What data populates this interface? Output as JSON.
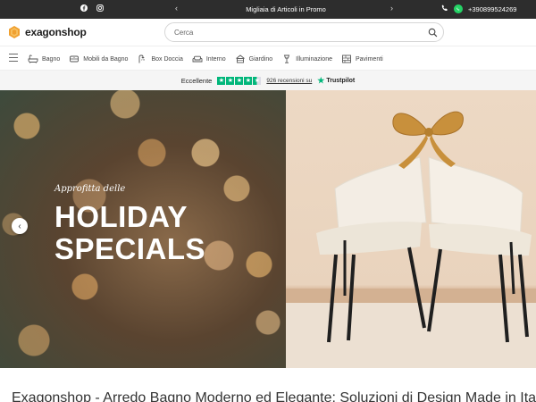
{
  "topbar": {
    "social": [
      {
        "icon": "facebook-icon"
      },
      {
        "icon": "instagram-icon"
      }
    ],
    "promo_text": "Migliaia di Articoli in Promo",
    "phone_icon": "phone-icon",
    "whatsapp_icon": "whatsapp-icon",
    "phone_number": "+390899524269"
  },
  "header": {
    "logo_text": "exagonshop",
    "search_placeholder": "Cerca"
  },
  "nav": {
    "items": [
      {
        "label": "Bagno",
        "icon": "bathtub-icon"
      },
      {
        "label": "Mobili da Bagno",
        "icon": "cabinet-icon"
      },
      {
        "label": "Box Doccia",
        "icon": "shower-icon"
      },
      {
        "label": "Interno",
        "icon": "sofa-icon"
      },
      {
        "label": "Giardino",
        "icon": "garden-icon"
      },
      {
        "label": "Illuminazione",
        "icon": "lamp-icon"
      },
      {
        "label": "Pavimenti",
        "icon": "floor-icon"
      }
    ]
  },
  "trust": {
    "rating_label": "Eccellente",
    "rating_stars": 4.5,
    "reviews_text": "926 recensioni su",
    "brand": "Trustpilot"
  },
  "hero": {
    "script_text": "Approfitta delle",
    "headline_line1": "HOLIDAY",
    "headline_line2": "SPECIALS",
    "prev_label": "‹"
  },
  "page": {
    "heading": "Exagonshop - Arredo Bagno Moderno ed Elegante: Soluzioni di Design Made in Italy"
  },
  "colors": {
    "topbar_bg": "#2d2d2d",
    "trustpilot_green": "#00b67a",
    "whatsapp_green": "#25d366",
    "logo_orange": "#f0a030",
    "ribbon_gold": "#c8903c"
  }
}
